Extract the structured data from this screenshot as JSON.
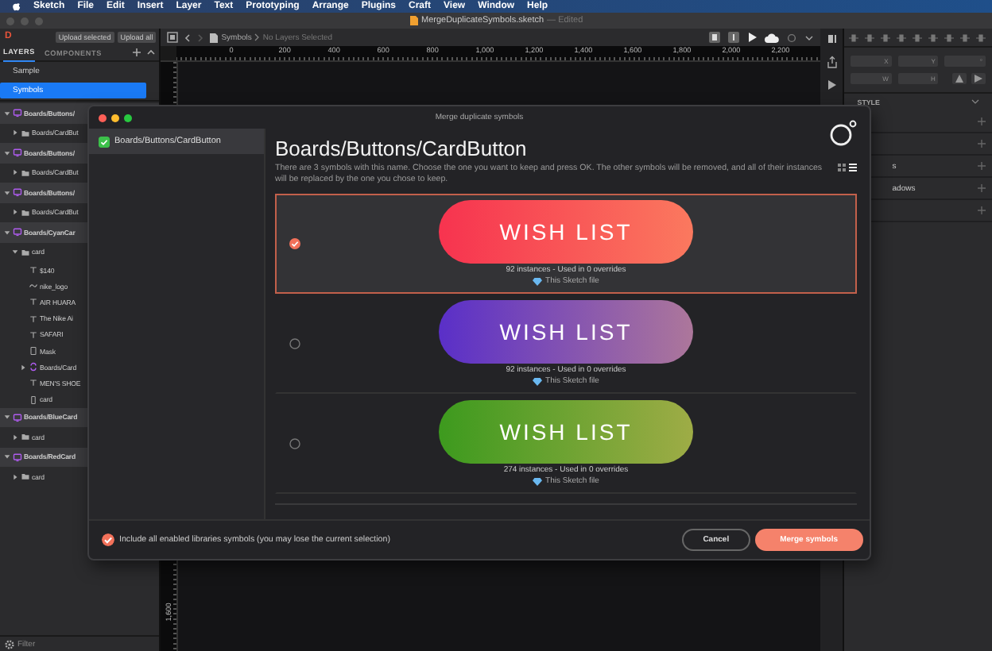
{
  "menu_bar": {
    "items": [
      "Sketch",
      "File",
      "Edit",
      "Insert",
      "Layer",
      "Text",
      "Prototyping",
      "Arrange",
      "Plugins",
      "Craft",
      "View",
      "Window",
      "Help"
    ]
  },
  "window": {
    "title": "MergeDuplicateSymbols.sketch",
    "status": "— Edited"
  },
  "left_panel": {
    "logo": "D",
    "upload_buttons": [
      "Upload selected",
      "Upload all"
    ],
    "tabs": [
      {
        "label": "LAYERS",
        "selected": true
      },
      {
        "label": "COMPONENTS",
        "selected": false
      }
    ],
    "pages": [
      {
        "label": "Sample",
        "selected": false
      },
      {
        "label": "Symbols",
        "selected": true
      }
    ],
    "layers": [
      {
        "name": "Boards/Buttons/",
        "kind": "symbol",
        "expanded": true,
        "children": [
          {
            "name": "Boards/CardBut",
            "kind": "group",
            "expanded": false
          }
        ]
      },
      {
        "name": "Boards/Buttons/",
        "kind": "symbol",
        "expanded": true,
        "children": [
          {
            "name": "Boards/CardBut",
            "kind": "group",
            "expanded": false
          }
        ]
      },
      {
        "name": "Boards/Buttons/",
        "kind": "symbol",
        "expanded": true,
        "children": [
          {
            "name": "Boards/CardBut",
            "kind": "group",
            "expanded": false
          }
        ]
      },
      {
        "name": "Boards/CyanCar",
        "kind": "symbol",
        "expanded": true,
        "children": [
          {
            "name": "card",
            "kind": "group",
            "expanded": true,
            "children": [
              {
                "name": "$140",
                "kind": "text"
              },
              {
                "name": "nike_logo",
                "kind": "shape"
              },
              {
                "name": "AIR HUARA",
                "kind": "text"
              },
              {
                "name": "The Nike Ai",
                "kind": "text"
              },
              {
                "name": "SAFARI",
                "kind": "text"
              },
              {
                "name": "Mask",
                "kind": "mask"
              },
              {
                "name": "Boards/Card",
                "kind": "instance",
                "expanded": false
              },
              {
                "name": "MEN'S SHOE",
                "kind": "text"
              },
              {
                "name": "card",
                "kind": "rect"
              }
            ]
          }
        ]
      },
      {
        "name": "Boards/BlueCard",
        "kind": "symbol",
        "expanded": true,
        "children": [
          {
            "name": "card",
            "kind": "group",
            "expanded": false
          }
        ]
      },
      {
        "name": "Boards/RedCard",
        "kind": "symbol",
        "expanded": true,
        "children": [
          {
            "name": "card",
            "kind": "group",
            "expanded": false
          }
        ]
      }
    ],
    "filter": {
      "placeholder": "Filter"
    }
  },
  "toolbar": {
    "breadcrumb": [
      "Symbols",
      "No Layers Selected"
    ]
  },
  "rulers": {
    "x_labels": [
      "0",
      "200",
      "400",
      "600",
      "800",
      "1,000",
      "1,200",
      "1,400",
      "1,600",
      "1,800",
      "2,000",
      "2,200"
    ],
    "y_label": "1,600"
  },
  "inspector": {
    "fields": [
      {
        "label": "X"
      },
      {
        "label": "Y"
      },
      {
        "label": "°"
      },
      {
        "label": "W"
      },
      {
        "label": "H"
      }
    ],
    "style_header": "STYLE",
    "style_rows": [
      {
        "kind": "plain"
      },
      {
        "kind": "plain"
      },
      {
        "kind": "labeled",
        "label": "s"
      },
      {
        "kind": "labeled",
        "label": "adows"
      },
      {
        "kind": "plain"
      }
    ]
  },
  "dialog": {
    "title": "Merge duplicate symbols",
    "sidebar": [
      {
        "label": "Boards/Buttons/CardButton",
        "selected": true,
        "checked": true
      }
    ],
    "heading": "Boards/Buttons/CardButton",
    "description": "There are 3 symbols with this name. Choose the one you want to keep and press OK. The other symbols will be removed, and all of their instances will be replaced by the one you chose to keep.",
    "options": [
      {
        "label": "WISH LIST",
        "color": "#f7334f",
        "usage": "92 instances - Used in 0 overrides",
        "source": "This Sketch file",
        "selected": true
      },
      {
        "label": "WISH LIST",
        "color": "#5a2fc8",
        "usage": "92 instances - Used in 0 overrides",
        "source": "This Sketch file",
        "selected": false
      },
      {
        "label": "WISH LIST",
        "color": "#3d9a1e",
        "usage": "274 instances - Used in 0 overrides",
        "source": "This Sketch file",
        "selected": false
      }
    ],
    "include_libraries": {
      "label": "Include all enabled libraries symbols (you may lose the current selection)",
      "checked": true
    },
    "buttons": [
      {
        "label": "Cancel",
        "kind": "secondary"
      },
      {
        "label": "Merge symbols",
        "kind": "primary"
      }
    ]
  }
}
